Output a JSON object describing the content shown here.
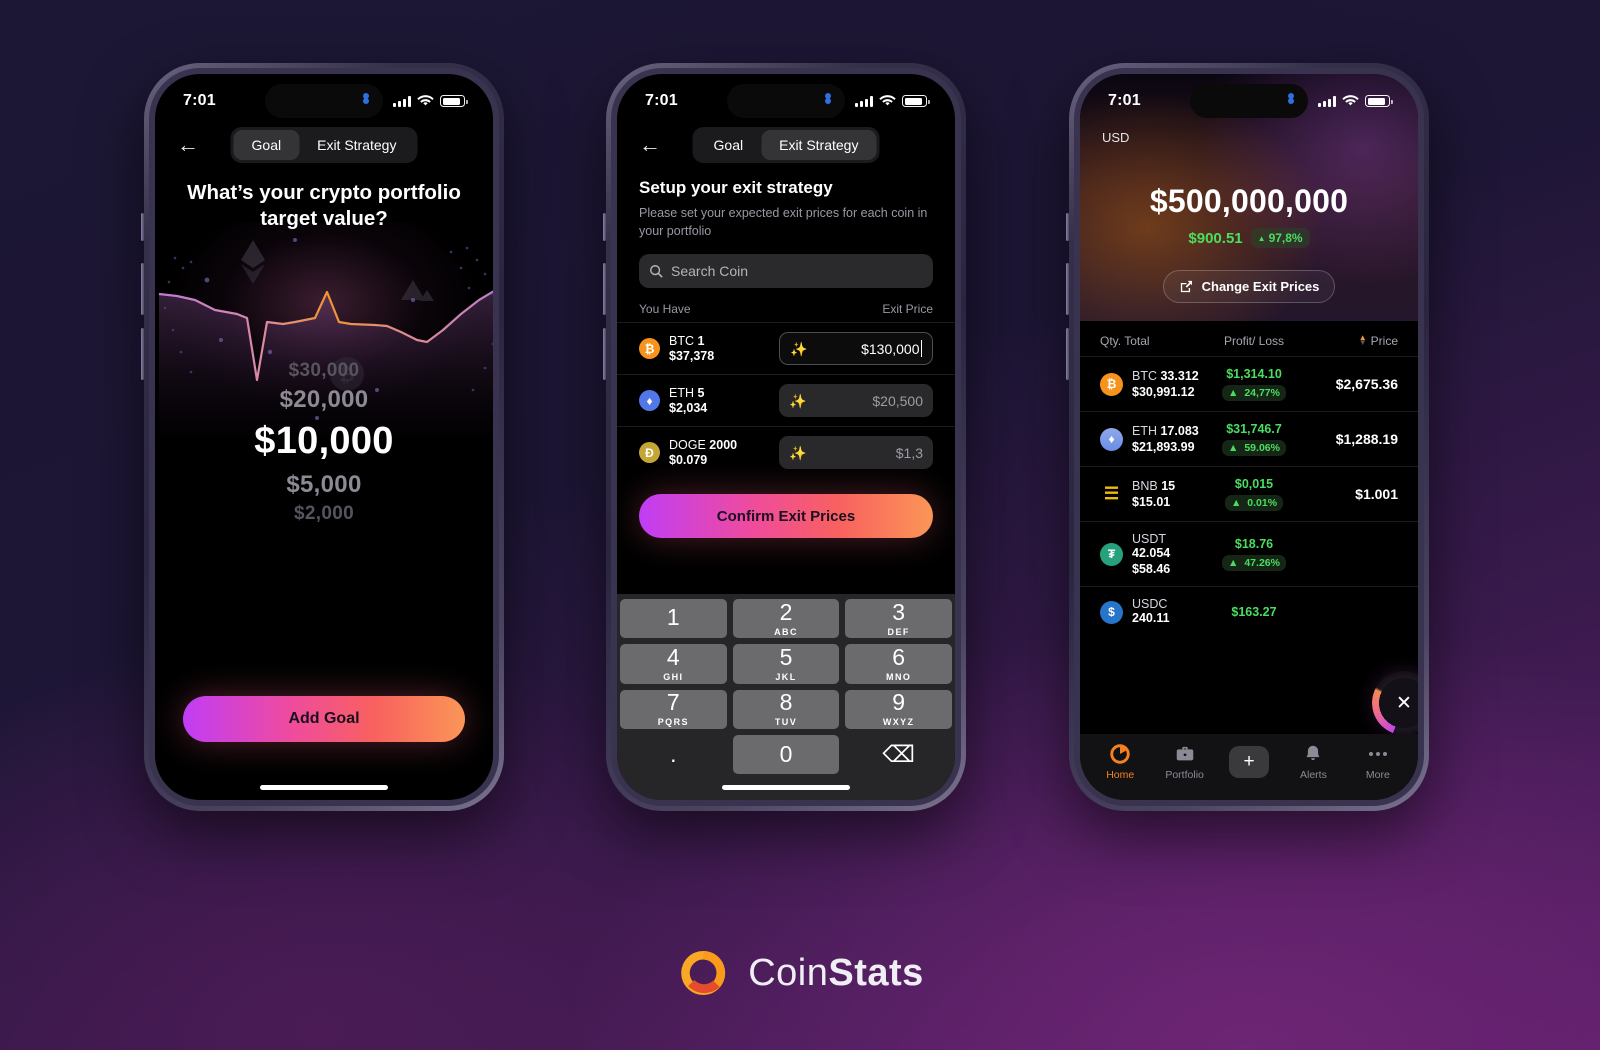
{
  "background": {
    "from": "#1c1734",
    "to": "#5d1f6b"
  },
  "brand": {
    "name_light": "Coin",
    "name_bold": "Stats",
    "logo_icon": "coinstats-donut-logo"
  },
  "status_bar": {
    "time": "7:01",
    "signal_icon": "cellular-bars-icon",
    "wifi_icon": "wifi-icon",
    "battery_icon": "battery-icon"
  },
  "phone1": {
    "back_icon": "back-arrow-icon",
    "tabs": [
      {
        "label": "Goal",
        "active": true
      },
      {
        "label": "Exit Strategy",
        "active": false
      }
    ],
    "title": "What’s your crypto portfolio target value?",
    "art_icons": [
      "ethereum-glyph",
      "bitcoin-glyph",
      "avalanche-glyph"
    ],
    "picker": {
      "far_above": "$30,000",
      "near_above": "$20,000",
      "selected": "$10,000",
      "near_below": "$5,000",
      "far_below": "$2,000"
    },
    "cta_label": "Add Goal"
  },
  "phone2": {
    "back_icon": "back-arrow-icon",
    "tabs": [
      {
        "label": "Goal",
        "active": false
      },
      {
        "label": "Exit Strategy",
        "active": true
      }
    ],
    "heading": "Setup your exit strategy",
    "subheading": "Please set your expected exit prices for each coin in your portfolio",
    "search": {
      "placeholder": "Search Coin",
      "value": "",
      "icon": "search-icon"
    },
    "columns": {
      "left": "You Have",
      "right": "Exit Price"
    },
    "coins": [
      {
        "icon": "bitcoin-icon",
        "icon_color": "#f7931a",
        "symbol": "BTC",
        "qty": "1",
        "price": "$37,378",
        "exit_price": "$130,000",
        "active": true
      },
      {
        "icon": "ethereum-icon",
        "icon_color": "#5277e8",
        "symbol": "ETH",
        "qty": "5",
        "price": "$2,034",
        "exit_price": "$20,500",
        "active": false
      },
      {
        "icon": "dogecoin-icon",
        "icon_color": "#c3a634",
        "symbol": "DOGE",
        "qty": "2000",
        "price": "$0.079",
        "exit_price": "$1,3",
        "active": false
      }
    ],
    "confirm_label": "Confirm Exit Prices",
    "keypad": [
      {
        "num": "1",
        "abc": ""
      },
      {
        "num": "2",
        "abc": "ABC"
      },
      {
        "num": "3",
        "abc": "DEF"
      },
      {
        "num": "4",
        "abc": "GHI"
      },
      {
        "num": "5",
        "abc": "JKL"
      },
      {
        "num": "6",
        "abc": "MNO"
      },
      {
        "num": "7",
        "abc": "PQRS"
      },
      {
        "num": "8",
        "abc": "TUV"
      },
      {
        "num": "9",
        "abc": "WXYZ"
      },
      {
        "num": ".",
        "abc": ""
      },
      {
        "num": "0",
        "abc": ""
      },
      {
        "num": "⌫",
        "abc": ""
      }
    ]
  },
  "phone3": {
    "currency": "USD",
    "total": "$500,000,000",
    "delta_amount": "$900.51",
    "delta_percent": "97,8%",
    "delta_arrow": "▲",
    "change_button": {
      "label": "Change Exit Prices",
      "icon": "edit-square-icon"
    },
    "table_headers": {
      "qty_total": "Qty. Total",
      "profit_loss": "Profit/ Loss",
      "price": "Price",
      "sort_icon": "sort-arrows-icon"
    },
    "rows": [
      {
        "icon": "bitcoin-icon",
        "icon_color": "#f7931a",
        "symbol": "BTC",
        "qty": "33.312",
        "total": "$30,991.12",
        "pl": "$1,314.10",
        "pl_pct": "24,77%",
        "price": "$2,675.36"
      },
      {
        "icon": "ethereum-icon",
        "icon_color": "#6b8de8",
        "symbol": "ETH",
        "qty": "17.083",
        "total": "$21,893.99",
        "pl": "$31,746.7",
        "pl_pct": "59.06%",
        "price": "$1,288.19"
      },
      {
        "icon": "bnb-icon",
        "icon_color": "#f0b90b",
        "symbol": "BNB",
        "qty": "15",
        "total": "$15.01",
        "pl": "$0,015",
        "pl_pct": "0.01%",
        "price": "$1.001"
      },
      {
        "icon": "tether-icon",
        "icon_color": "#26a17b",
        "symbol": "USDT",
        "qty": "42.054",
        "total": "$58.46",
        "pl": "$18.76",
        "pl_pct": "47.26%",
        "price": ""
      },
      {
        "icon": "usdc-icon",
        "icon_color": "#2775ca",
        "symbol": "USDC",
        "qty": "240.11",
        "total": "",
        "pl": "$163.27",
        "pl_pct": "",
        "price": ""
      }
    ],
    "fab": {
      "icon": "close-x-icon"
    },
    "tabbar": [
      {
        "label": "Home",
        "icon": "home-donut-icon",
        "active": true
      },
      {
        "label": "Portfolio",
        "icon": "briefcase-icon",
        "active": false
      },
      {
        "label": "",
        "icon": "plus-icon",
        "active": false
      },
      {
        "label": "Alerts",
        "icon": "bell-icon",
        "active": false
      },
      {
        "label": "More",
        "icon": "more-dots-icon",
        "active": false
      }
    ]
  }
}
